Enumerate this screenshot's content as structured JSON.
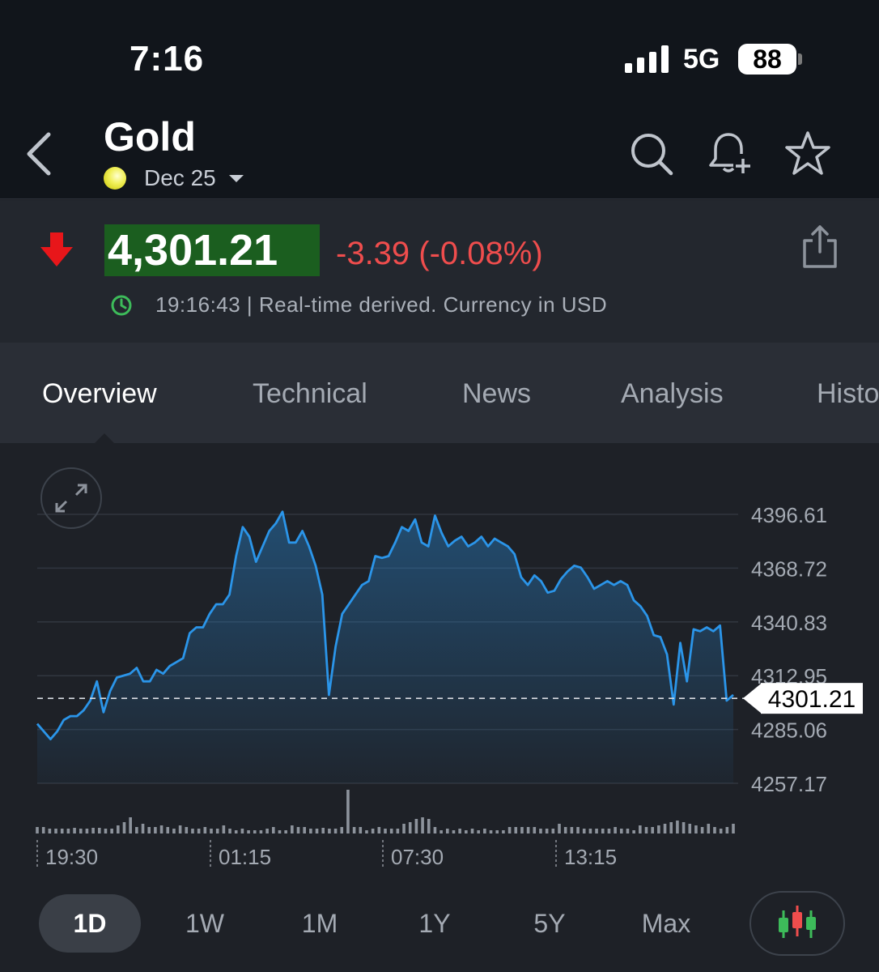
{
  "status": {
    "time": "7:16",
    "network": "5G",
    "battery": "88"
  },
  "header": {
    "title": "Gold",
    "contract": "Dec 25"
  },
  "quote": {
    "price": "4,301.21",
    "change": "-3.39 (-0.08%)",
    "meta": "19:16:43 | Real-time derived. Currency in USD",
    "colors": {
      "down": "#ef4d4d",
      "price_bg": "#1b5e1f",
      "line": "#2b95e9"
    }
  },
  "tabs": [
    {
      "label": "Overview",
      "active": true
    },
    {
      "label": "Technical"
    },
    {
      "label": "News"
    },
    {
      "label": "Analysis"
    },
    {
      "label": "Histo"
    }
  ],
  "ranges": [
    {
      "label": "1D",
      "active": true
    },
    {
      "label": "1W"
    },
    {
      "label": "1M"
    },
    {
      "label": "1Y"
    },
    {
      "label": "5Y"
    },
    {
      "label": "Max"
    }
  ],
  "chart_data": {
    "type": "area",
    "y_ticks": [
      "4396.61",
      "4368.72",
      "4340.83",
      "4312.95",
      "4285.06",
      "4257.17"
    ],
    "ylim": [
      4257.17,
      4396.61
    ],
    "x_ticks": [
      "19:30",
      "01:15",
      "07:30",
      "13:15"
    ],
    "current_label": "4301.21",
    "current_value": 4301.21,
    "series": [
      {
        "values": [
          4288,
          4284,
          4280,
          4284,
          4290,
          4292,
          4292,
          4295,
          4300,
          4310,
          4294,
          4305,
          4312,
          4313,
          4314,
          4317,
          4310,
          4310,
          4316,
          4314,
          4318,
          4320,
          4322,
          4335,
          4338,
          4338,
          4345,
          4350,
          4350,
          4355,
          4375,
          4390,
          4385,
          4372,
          4380,
          4388,
          4392,
          4398,
          4382,
          4382,
          4388,
          4380,
          4370,
          4355,
          4303,
          4328,
          4345,
          4350,
          4355,
          4360,
          4362,
          4375,
          4374,
          4375,
          4382,
          4390,
          4388,
          4394,
          4382,
          4380,
          4396,
          4387,
          4380,
          4383,
          4385,
          4380,
          4382,
          4385,
          4380,
          4384,
          4382,
          4380,
          4376,
          4364,
          4360,
          4365,
          4362,
          4356,
          4357,
          4363,
          4367,
          4370,
          4369,
          4364,
          4358,
          4360,
          4362,
          4360,
          4362,
          4360,
          4352,
          4349,
          4344,
          4334,
          4333,
          4324,
          4298,
          4330,
          4310,
          4337,
          4336,
          4338,
          4336,
          4339,
          4300,
          4303
        ],
        "volumes": [
          8,
          8,
          6,
          6,
          6,
          6,
          7,
          6,
          6,
          7,
          7,
          6,
          6,
          10,
          14,
          20,
          8,
          12,
          8,
          8,
          10,
          8,
          6,
          10,
          8,
          6,
          6,
          8,
          6,
          6,
          10,
          6,
          4,
          6,
          4,
          4,
          4,
          6,
          8,
          4,
          4,
          10,
          8,
          8,
          6,
          6,
          7,
          6,
          6,
          8,
          54,
          8,
          8,
          4,
          6,
          8,
          6,
          6,
          6,
          12,
          14,
          18,
          20,
          18,
          8,
          4,
          6,
          4,
          6,
          4,
          6,
          4,
          6,
          4,
          4,
          4,
          8,
          8,
          8,
          8,
          8,
          6,
          6,
          6,
          12,
          8,
          8,
          8,
          6,
          6,
          6,
          6,
          6,
          8,
          6,
          6,
          4,
          10,
          8,
          8,
          10,
          12,
          14,
          16,
          14,
          12,
          10,
          8,
          12,
          8,
          6,
          8,
          12
        ]
      }
    ]
  }
}
